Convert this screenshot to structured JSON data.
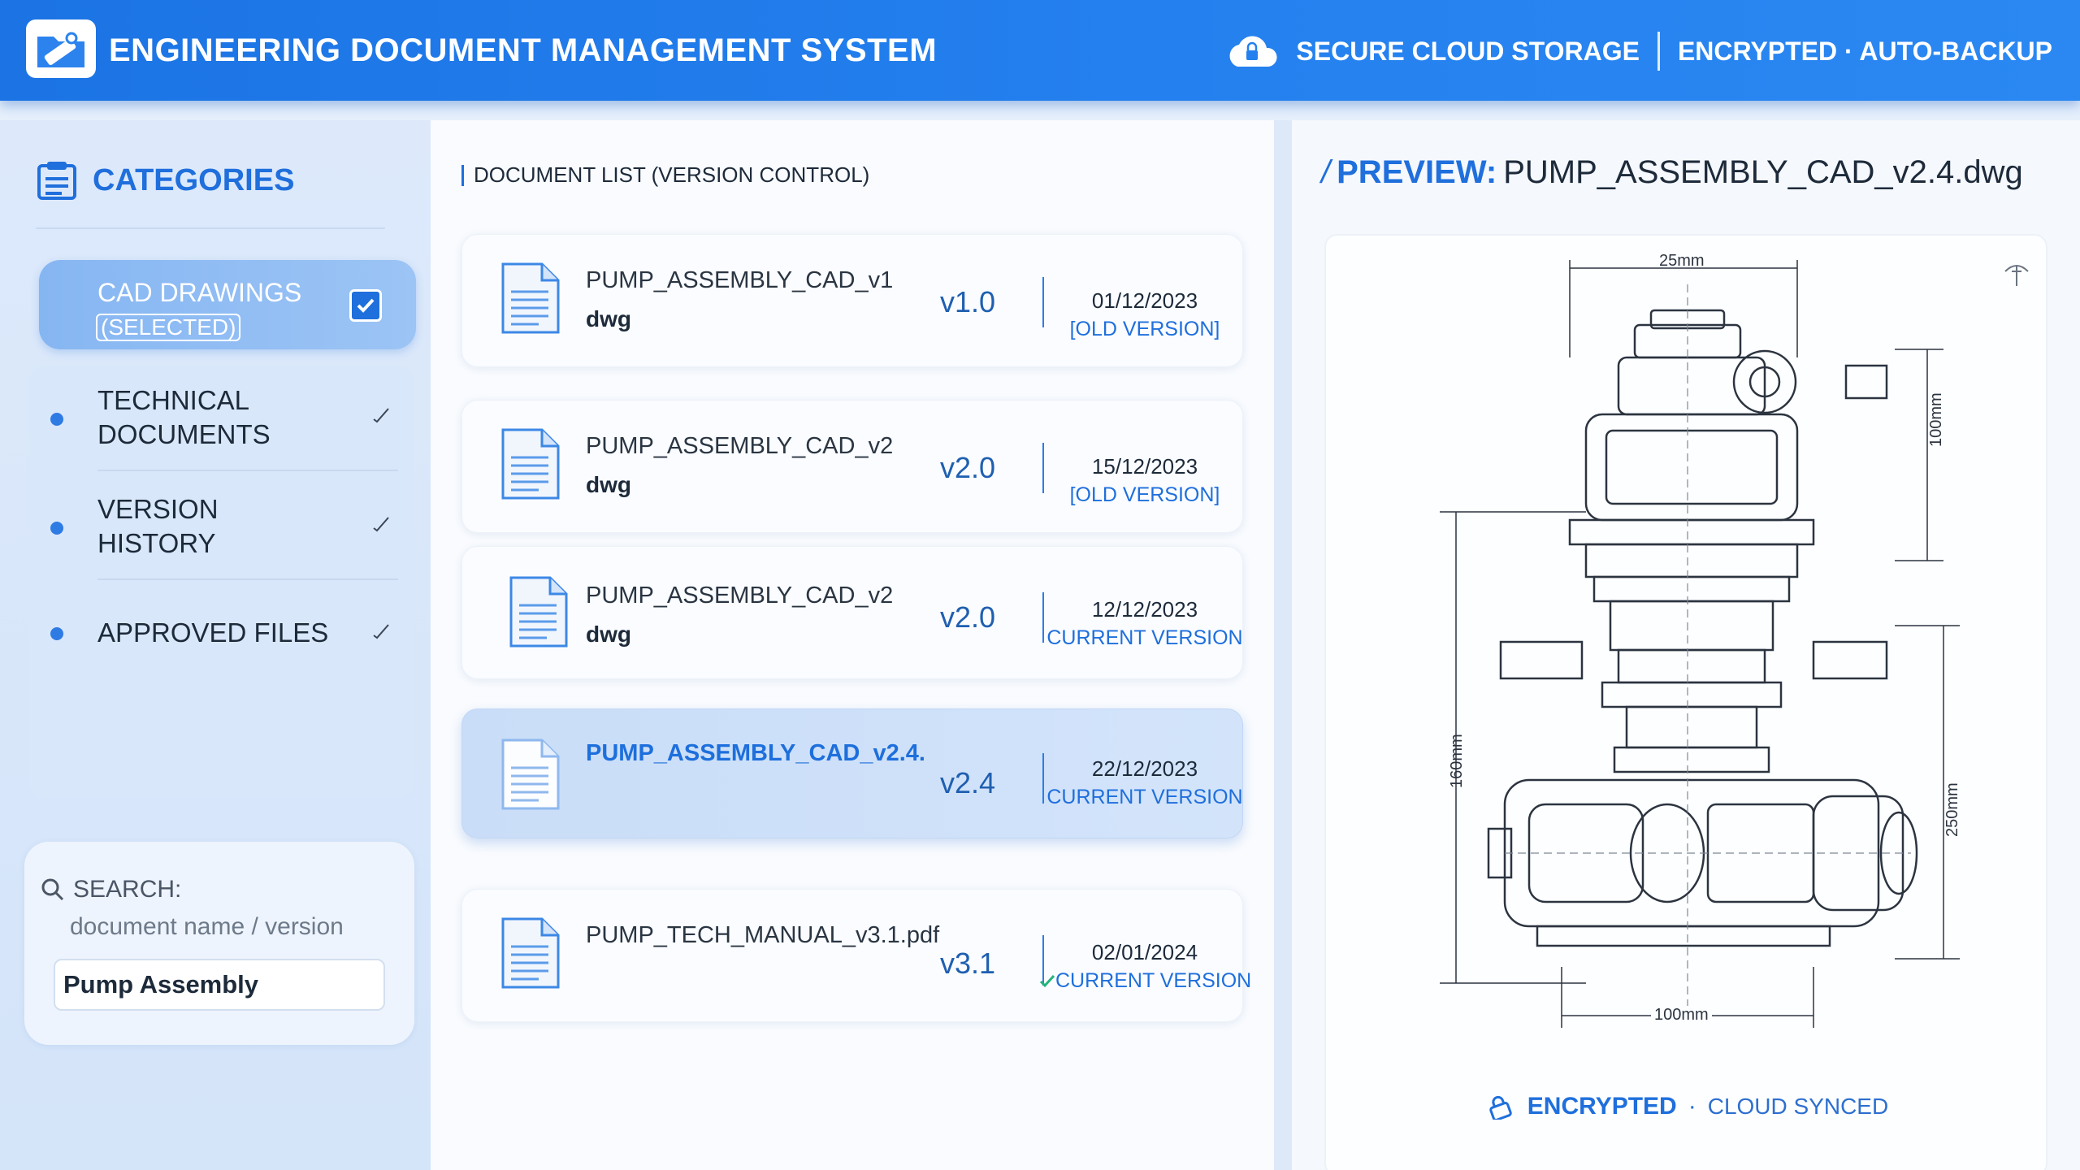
{
  "header": {
    "title": "ENGINEERING DOCUMENT MANAGEMENT SYSTEM",
    "storage_label": "SECURE CLOUD STORAGE",
    "security_label": "ENCRYPTED · AUTO-BACKUP"
  },
  "sidebar": {
    "title": "CATEGORIES",
    "selected": {
      "label": "CAD DRAWINGS",
      "tag": "(SELECTED)"
    },
    "items": [
      {
        "line1": "TECHNICAL",
        "line2": "DOCUMENTS"
      },
      {
        "line1": "VERSION",
        "line2": "HISTORY"
      },
      {
        "line1": "APPROVED FILES",
        "line2": ""
      }
    ],
    "search": {
      "label": "SEARCH:",
      "hint": "document name  /  version",
      "value": "Pump Assembly"
    }
  },
  "documents": {
    "heading": "DOCUMENT LIST (VERSION CONTROL)",
    "items": [
      {
        "name": "PUMP_ASSEMBLY_CAD_v1",
        "ext": "dwg",
        "version": "v1.0",
        "date": "01/12/2023",
        "status": "[OLD VERSION]"
      },
      {
        "name": "PUMP_ASSEMBLY_CAD_v2",
        "ext": "dwg",
        "version": "v2.0",
        "date": "15/12/2023",
        "status": "[OLD VERSION]"
      },
      {
        "name": "PUMP_ASSEMBLY_CAD_v2",
        "ext": "dwg",
        "version": "v2.0",
        "date": "12/12/2023",
        "status": "CURRENT VERSION"
      },
      {
        "name": "PUMP_ASSEMBLY_CAD_v2.4.",
        "ext": "",
        "version": "v2.4",
        "date": "22/12/2023",
        "status": "CURRENT VERSION",
        "selected": true
      },
      {
        "name": "PUMP_TECH_MANUAL_v3.1.pdf",
        "ext": "",
        "version": "v3.1",
        "date": "02/01/2024",
        "status": "CURRENT VERSION"
      }
    ]
  },
  "preview": {
    "prefix": "PREVIEW:",
    "filename": "PUMP_ASSEMBLY_CAD_v2.4.dwg",
    "dimensions": {
      "top": "25mm",
      "right_upper": "100mm",
      "left": "160mm",
      "right_lower": "250mm",
      "bottom": "100mm"
    },
    "footer_encrypted": "ENCRYPTED",
    "footer_sync": "CLOUD SYNCED"
  },
  "colors": {
    "header_blue": "#1c74e4",
    "accent_blue": "#1f6fdc",
    "selected_bg": "#86b6f2",
    "current_ok": "#23b47a"
  }
}
